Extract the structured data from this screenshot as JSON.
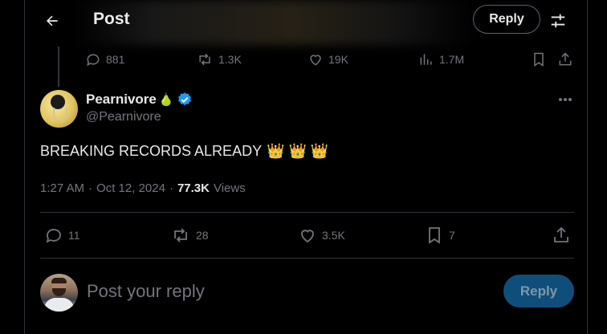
{
  "header": {
    "title": "Post",
    "reply_label": "Reply",
    "back_icon": "arrow-left-icon",
    "settings_icon": "sliders-icon"
  },
  "previous_post": {
    "replies": "881",
    "reposts": "1.3K",
    "likes": "19K",
    "views": "1.7M"
  },
  "post": {
    "display_name": "Pearnivore",
    "name_emoji": "🍐",
    "verified": true,
    "handle": "@Pearnivore",
    "text": "BREAKING RECORDS ALREADY",
    "emojis": [
      "👑",
      "👑",
      "👑"
    ],
    "time": "1:27 AM",
    "date": "Oct 12, 2024",
    "views_count": "77.3K",
    "views_label": "Views",
    "replies": "11",
    "reposts": "28",
    "likes": "3.5K",
    "bookmarks": "7"
  },
  "composer": {
    "placeholder": "Post your reply",
    "submit_label": "Reply"
  },
  "colors": {
    "background": "#000000",
    "text_primary": "#e7e9ea",
    "text_secondary": "#71767b",
    "border": "#2f3336",
    "accent_blue": "#1d9bf0",
    "reply_button_disabled": "#0f4e7a"
  }
}
